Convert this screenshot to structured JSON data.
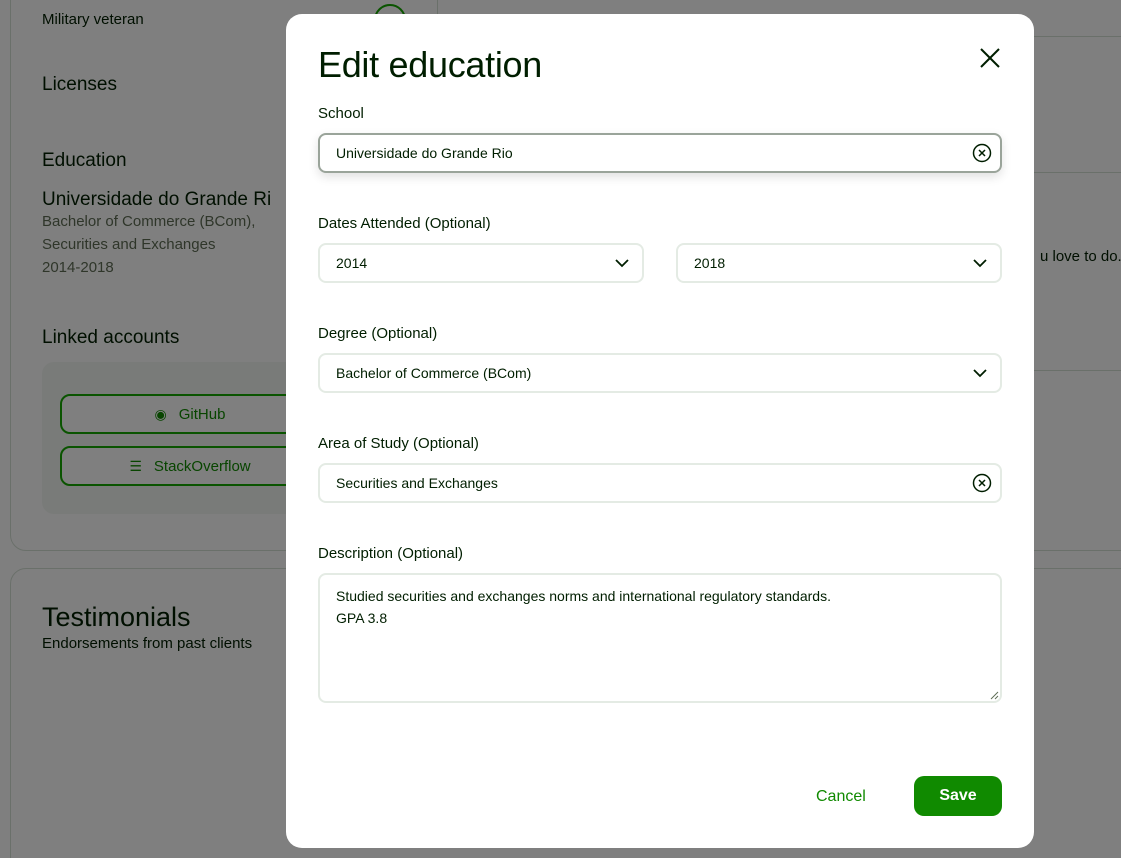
{
  "background": {
    "veteran_label": "Military veteran",
    "licenses_title": "Licenses",
    "education_title": "Education",
    "education": {
      "school": "Universidade do Grande Ri",
      "degree": "Bachelor of Commerce (BCom),",
      "area": "Securities and Exchanges",
      "years": "2014-2018"
    },
    "linked_accounts_title": "Linked accounts",
    "linked_accounts": [
      {
        "label": "GitHub",
        "icon": "github-icon"
      },
      {
        "label": "StackOverflow",
        "icon": "stackoverflow-icon"
      }
    ],
    "testimonials_title": "Testimonials",
    "testimonials_subtitle": "Endorsements from past clients",
    "right_peek_text": "u love to do. C"
  },
  "modal": {
    "title": "Edit education",
    "close_icon": "close-icon",
    "school": {
      "label": "School",
      "value": "Universidade do Grande Rio"
    },
    "dates": {
      "label": "Dates Attended (Optional)",
      "from": "2014",
      "to": "2018"
    },
    "degree": {
      "label": "Degree (Optional)",
      "value": "Bachelor of Commerce (BCom)"
    },
    "area": {
      "label": "Area of Study (Optional)",
      "value": "Securities and Exchanges"
    },
    "description": {
      "label": "Description (Optional)",
      "value": "Studied securities and exchanges norms and international regulatory standards.\nGPA 3.8"
    },
    "cancel_label": "Cancel",
    "save_label": "Save"
  },
  "colors": {
    "accent": "#108a00",
    "overlay": "rgba(0,0,0,0.5)"
  }
}
